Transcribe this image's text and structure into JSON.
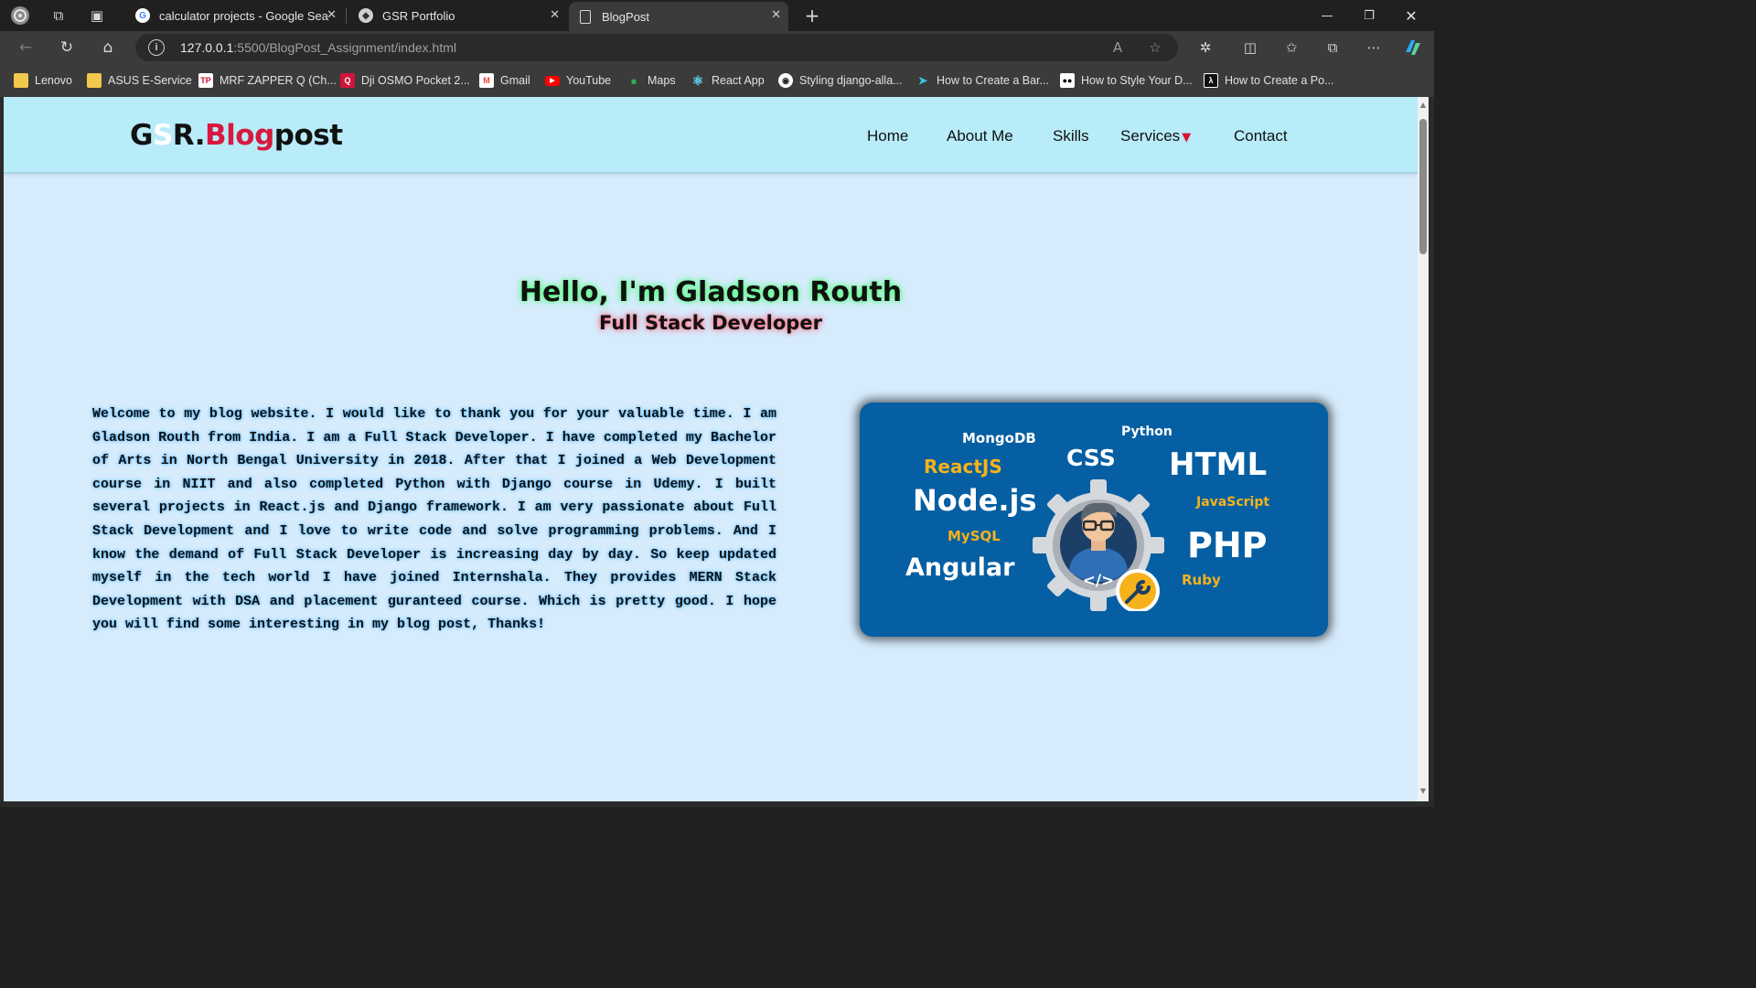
{
  "browser": {
    "tabs": [
      {
        "title": "calculator projects - Google Sear",
        "favicon": "google-icon"
      },
      {
        "title": "GSR Portfolio",
        "favicon": "site-icon"
      },
      {
        "title": "BlogPost",
        "favicon": "page-icon",
        "active": true
      }
    ],
    "url_host": "127.0.0.1",
    "url_path": ":5500/BlogPost_Assignment/index.html",
    "bookmarks": [
      {
        "label": "Lenovo",
        "icon": "folder-icon",
        "color": "#f2c94c"
      },
      {
        "label": "ASUS E-Service",
        "icon": "folder-icon",
        "color": "#f2c94c"
      },
      {
        "label": "MRF ZAPPER Q (Ch...",
        "icon": "tp-icon",
        "color": "#c8102e"
      },
      {
        "label": "Dji OSMO Pocket 2...",
        "icon": "q-icon",
        "color": "#d2143a"
      },
      {
        "label": "Gmail",
        "icon": "gmail-icon",
        "color": "#ea4335"
      },
      {
        "label": "YouTube",
        "icon": "youtube-icon",
        "color": "#ff0000"
      },
      {
        "label": "Maps",
        "icon": "maps-icon",
        "color": "#34a853"
      },
      {
        "label": "React App",
        "icon": "react-icon",
        "color": "#61dafb"
      },
      {
        "label": "Styling django-alla...",
        "icon": "github-icon",
        "color": "#ffffff"
      },
      {
        "label": "How to Create a Bar...",
        "icon": "bird-icon",
        "color": "#39c5e0"
      },
      {
        "label": "How to Style Your D...",
        "icon": "medium-icon",
        "color": "#ffffff"
      },
      {
        "label": "How to Create a Po...",
        "icon": "lambda-icon",
        "color": "#ffffff"
      }
    ]
  },
  "site": {
    "logo": {
      "g": "G",
      "s": "S",
      "r": "R.",
      "blog": "Blog",
      "post": "post"
    },
    "nav": {
      "home": "Home",
      "about": "About Me",
      "skills": "Skills",
      "services": "Services",
      "services_caret": "▼",
      "contact": "Contact"
    },
    "hero": {
      "title": "Hello, I'm Gladson Routh",
      "subtitle": "Full Stack Developer"
    },
    "intro": "Welcome to my blog website. I would like to thank you for your valuable time. I am Gladson Routh from India. I am a Full Stack Developer. I have completed my Bachelor of Arts in North Bengal University in 2018. After that I joined a Web Development course in NIIT and also completed Python with Django course in Udemy. I built several projects in React.js and Django framework. I am very passionate about Full Stack Development and I love to write code and solve programming problems. And I know the demand of Full Stack Developer is increasing day by day. So keep updated myself in the tech world I have joined Internshala. They provides MERN Stack Development with DSA and placement guranteed course. Which is pretty good. I hope you will find some interesting in my blog post, Thanks!",
    "skills_image": {
      "mongodb": "MongoDB",
      "python": "Python",
      "reactjs": "ReactJS",
      "css": "CSS",
      "html": "HTML",
      "nodejs": "Node.js",
      "javascript": "JavaScript",
      "mysql": "MySQL",
      "php": "PHP",
      "angular": "Angular",
      "ruby": "Ruby",
      "code_tag": "</>",
      "accent_yellow": "#f6b21b",
      "background": "#055fa2"
    }
  }
}
